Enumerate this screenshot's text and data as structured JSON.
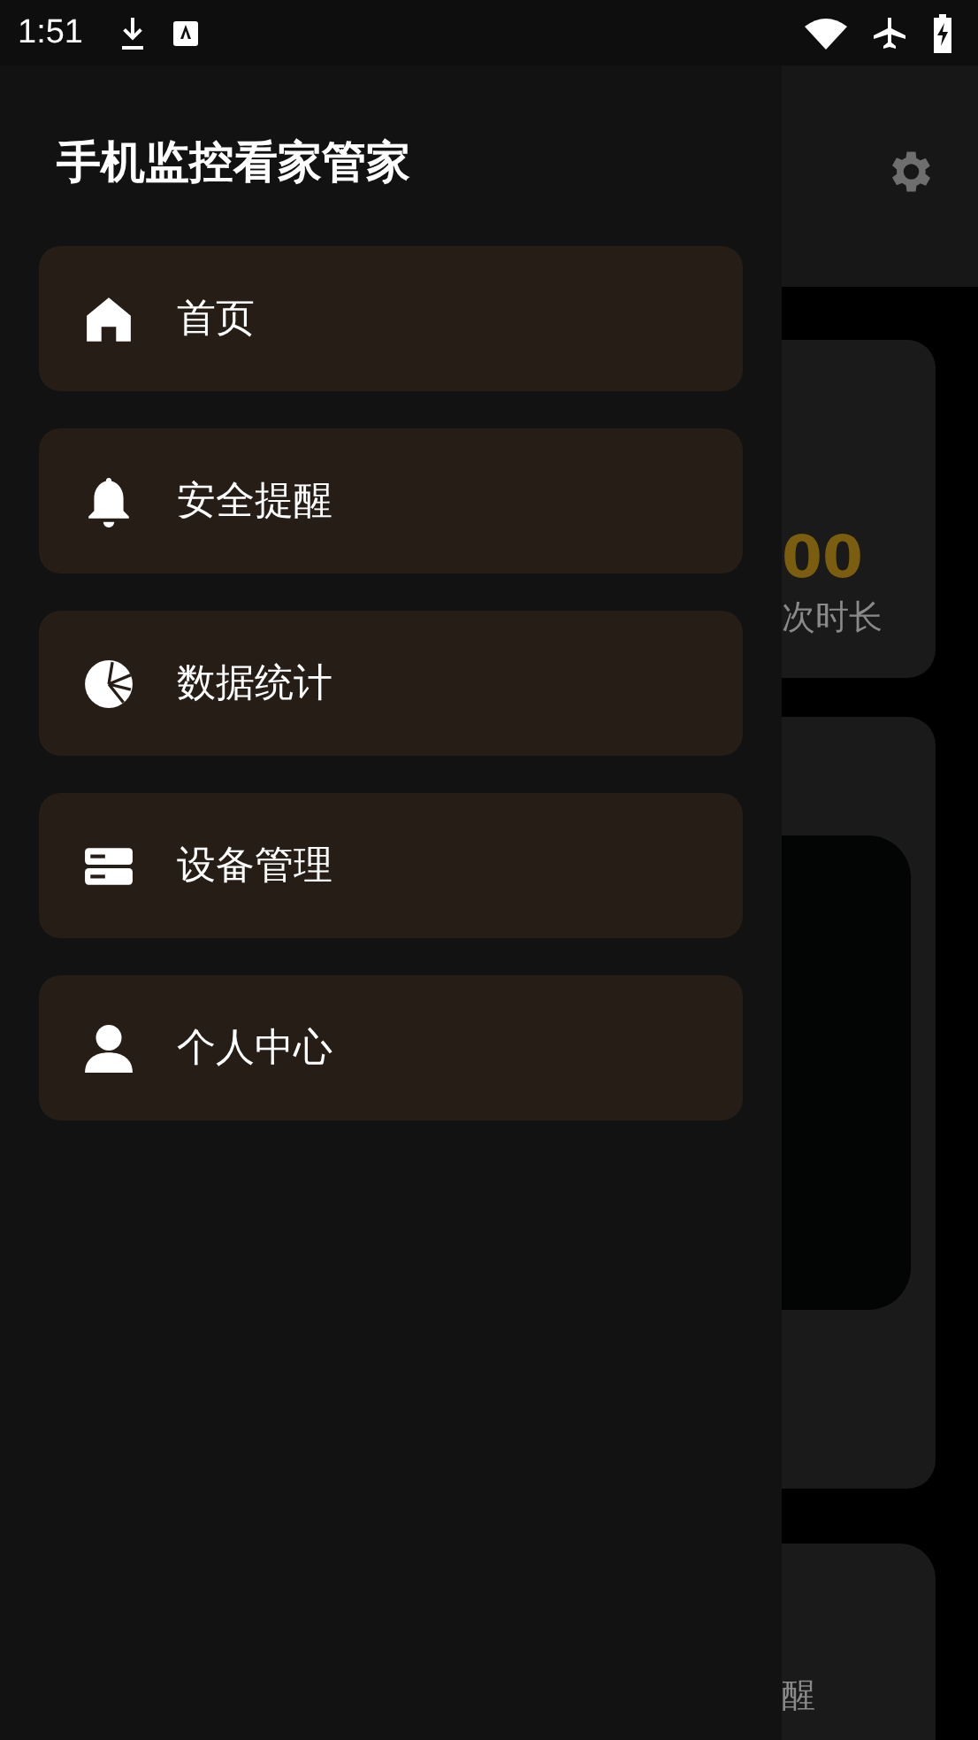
{
  "status_bar": {
    "time": "1:51"
  },
  "drawer": {
    "title": "手机监控看家管家",
    "items": [
      {
        "label": "首页"
      },
      {
        "label": "安全提醒"
      },
      {
        "label": "数据统计"
      },
      {
        "label": "设备管理"
      },
      {
        "label": "个人中心"
      }
    ]
  },
  "background_page": {
    "stat_value": "00",
    "stat_label": "次时长",
    "bottom_label": "醒"
  }
}
